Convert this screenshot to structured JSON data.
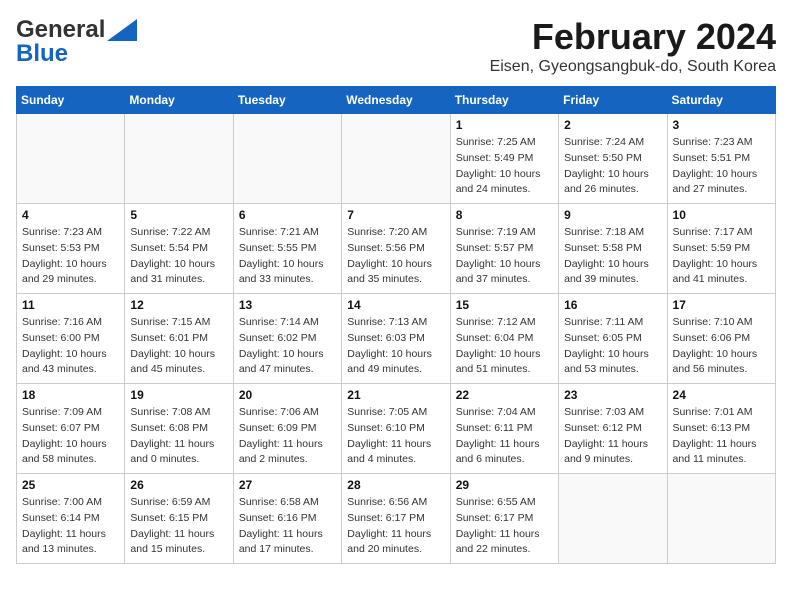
{
  "header": {
    "logo_line1": "General",
    "logo_line2": "Blue",
    "month": "February 2024",
    "location": "Eisen, Gyeongsangbuk-do, South Korea"
  },
  "weekdays": [
    "Sunday",
    "Monday",
    "Tuesday",
    "Wednesday",
    "Thursday",
    "Friday",
    "Saturday"
  ],
  "weeks": [
    [
      {
        "day": "",
        "info": ""
      },
      {
        "day": "",
        "info": ""
      },
      {
        "day": "",
        "info": ""
      },
      {
        "day": "",
        "info": ""
      },
      {
        "day": "1",
        "info": "Sunrise: 7:25 AM\nSunset: 5:49 PM\nDaylight: 10 hours\nand 24 minutes."
      },
      {
        "day": "2",
        "info": "Sunrise: 7:24 AM\nSunset: 5:50 PM\nDaylight: 10 hours\nand 26 minutes."
      },
      {
        "day": "3",
        "info": "Sunrise: 7:23 AM\nSunset: 5:51 PM\nDaylight: 10 hours\nand 27 minutes."
      }
    ],
    [
      {
        "day": "4",
        "info": "Sunrise: 7:23 AM\nSunset: 5:53 PM\nDaylight: 10 hours\nand 29 minutes."
      },
      {
        "day": "5",
        "info": "Sunrise: 7:22 AM\nSunset: 5:54 PM\nDaylight: 10 hours\nand 31 minutes."
      },
      {
        "day": "6",
        "info": "Sunrise: 7:21 AM\nSunset: 5:55 PM\nDaylight: 10 hours\nand 33 minutes."
      },
      {
        "day": "7",
        "info": "Sunrise: 7:20 AM\nSunset: 5:56 PM\nDaylight: 10 hours\nand 35 minutes."
      },
      {
        "day": "8",
        "info": "Sunrise: 7:19 AM\nSunset: 5:57 PM\nDaylight: 10 hours\nand 37 minutes."
      },
      {
        "day": "9",
        "info": "Sunrise: 7:18 AM\nSunset: 5:58 PM\nDaylight: 10 hours\nand 39 minutes."
      },
      {
        "day": "10",
        "info": "Sunrise: 7:17 AM\nSunset: 5:59 PM\nDaylight: 10 hours\nand 41 minutes."
      }
    ],
    [
      {
        "day": "11",
        "info": "Sunrise: 7:16 AM\nSunset: 6:00 PM\nDaylight: 10 hours\nand 43 minutes."
      },
      {
        "day": "12",
        "info": "Sunrise: 7:15 AM\nSunset: 6:01 PM\nDaylight: 10 hours\nand 45 minutes."
      },
      {
        "day": "13",
        "info": "Sunrise: 7:14 AM\nSunset: 6:02 PM\nDaylight: 10 hours\nand 47 minutes."
      },
      {
        "day": "14",
        "info": "Sunrise: 7:13 AM\nSunset: 6:03 PM\nDaylight: 10 hours\nand 49 minutes."
      },
      {
        "day": "15",
        "info": "Sunrise: 7:12 AM\nSunset: 6:04 PM\nDaylight: 10 hours\nand 51 minutes."
      },
      {
        "day": "16",
        "info": "Sunrise: 7:11 AM\nSunset: 6:05 PM\nDaylight: 10 hours\nand 53 minutes."
      },
      {
        "day": "17",
        "info": "Sunrise: 7:10 AM\nSunset: 6:06 PM\nDaylight: 10 hours\nand 56 minutes."
      }
    ],
    [
      {
        "day": "18",
        "info": "Sunrise: 7:09 AM\nSunset: 6:07 PM\nDaylight: 10 hours\nand 58 minutes."
      },
      {
        "day": "19",
        "info": "Sunrise: 7:08 AM\nSunset: 6:08 PM\nDaylight: 11 hours\nand 0 minutes."
      },
      {
        "day": "20",
        "info": "Sunrise: 7:06 AM\nSunset: 6:09 PM\nDaylight: 11 hours\nand 2 minutes."
      },
      {
        "day": "21",
        "info": "Sunrise: 7:05 AM\nSunset: 6:10 PM\nDaylight: 11 hours\nand 4 minutes."
      },
      {
        "day": "22",
        "info": "Sunrise: 7:04 AM\nSunset: 6:11 PM\nDaylight: 11 hours\nand 6 minutes."
      },
      {
        "day": "23",
        "info": "Sunrise: 7:03 AM\nSunset: 6:12 PM\nDaylight: 11 hours\nand 9 minutes."
      },
      {
        "day": "24",
        "info": "Sunrise: 7:01 AM\nSunset: 6:13 PM\nDaylight: 11 hours\nand 11 minutes."
      }
    ],
    [
      {
        "day": "25",
        "info": "Sunrise: 7:00 AM\nSunset: 6:14 PM\nDaylight: 11 hours\nand 13 minutes."
      },
      {
        "day": "26",
        "info": "Sunrise: 6:59 AM\nSunset: 6:15 PM\nDaylight: 11 hours\nand 15 minutes."
      },
      {
        "day": "27",
        "info": "Sunrise: 6:58 AM\nSunset: 6:16 PM\nDaylight: 11 hours\nand 17 minutes."
      },
      {
        "day": "28",
        "info": "Sunrise: 6:56 AM\nSunset: 6:17 PM\nDaylight: 11 hours\nand 20 minutes."
      },
      {
        "day": "29",
        "info": "Sunrise: 6:55 AM\nSunset: 6:17 PM\nDaylight: 11 hours\nand 22 minutes."
      },
      {
        "day": "",
        "info": ""
      },
      {
        "day": "",
        "info": ""
      }
    ]
  ]
}
